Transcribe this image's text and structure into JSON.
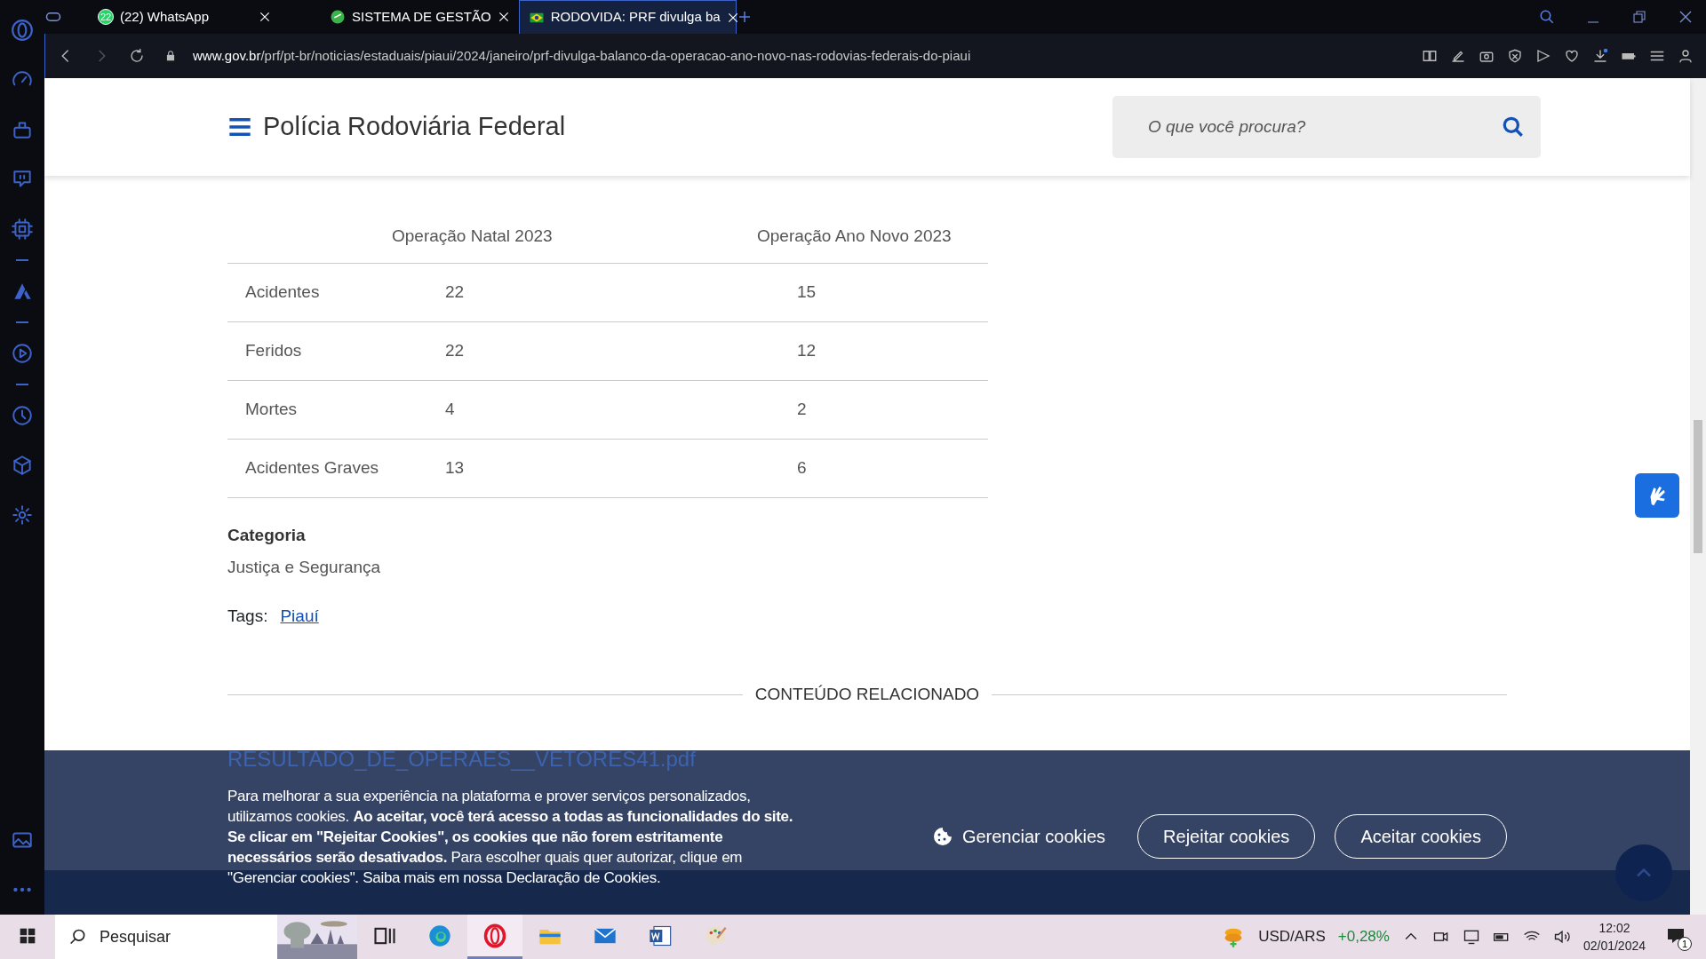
{
  "browser": {
    "tabs": [
      {
        "title": "(22) WhatsApp",
        "badge": "22",
        "kind": "whatsapp",
        "selected": false
      },
      {
        "title": "SISTEMA DE GESTÃO",
        "kind": "system",
        "selected": false
      },
      {
        "title": "RODOVIDA: PRF divulga ba",
        "kind": "flag",
        "selected": true
      }
    ],
    "url_host": "www.gov.br",
    "url_path": "/prf/pt-br/noticias/estaduais/piaui/2024/janeiro/prf-divulga-balanco-da-operacao-ano-novo-nas-rodovias-federais-do-piaui"
  },
  "sidebar": [
    {
      "kind": "speed"
    },
    {
      "kind": "broom"
    },
    {
      "kind": "chat"
    },
    {
      "kind": "chip"
    },
    {
      "kind": "divider"
    },
    {
      "kind": "aria"
    },
    {
      "kind": "divider"
    },
    {
      "kind": "play"
    },
    {
      "kind": "divider"
    },
    {
      "kind": "clock"
    },
    {
      "kind": "cube"
    },
    {
      "kind": "gear"
    }
  ],
  "site": {
    "title": "Polícia Rodoviária Federal",
    "search_placeholder": "O que você procura?"
  },
  "table": {
    "columns": [
      "Operação Natal 2023",
      "Operação Ano Novo 2023"
    ],
    "rows": [
      {
        "label": "Acidentes",
        "values": [
          "22",
          "15"
        ]
      },
      {
        "label": "Feridos",
        "values": [
          "22",
          "12"
        ]
      },
      {
        "label": "Mortes",
        "values": [
          "4",
          "2"
        ]
      },
      {
        "label": "Acidentes Graves",
        "values": [
          "13",
          "6"
        ]
      }
    ]
  },
  "category": {
    "heading": "Categoria",
    "value": "Justiça e Segurança"
  },
  "tags": {
    "label": "Tags:",
    "items": [
      "Piauí"
    ]
  },
  "related": {
    "heading": "CONTEÚDO RELACIONADO",
    "items": [
      "RESULTADO_DE_OPERAES__VETORES41.pdf"
    ]
  },
  "cookie_banner": {
    "text": "Para melhorar a sua experiência na plataforma e prover serviços personalizados, utilizamos cookies. **Ao aceitar, você terá acesso a todas as funcionalidades do site. Se clicar em \"Rejeitar Cookies\", os cookies que não forem estritamente necessários serão desativados.** Para escolher quais quer autorizar, clique em \"Gerenciar cookies\". Saiba mais em nossa",
    "link": "Declaração de Cookies",
    "suffix": ".",
    "buttons": [
      {
        "label": "Gerenciar cookies",
        "kind": "manage"
      },
      {
        "label": "Rejeitar cookies",
        "kind": "outline"
      },
      {
        "label": "Aceitar cookies",
        "kind": "outline"
      }
    ]
  },
  "taskbar": {
    "search_placeholder": "Pesquisar",
    "apps": [
      {
        "kind": "taskview",
        "selected": false
      },
      {
        "kind": "edge",
        "selected": false
      },
      {
        "kind": "opera",
        "selected": true
      },
      {
        "kind": "folder",
        "selected": false
      },
      {
        "kind": "mail",
        "selected": false
      },
      {
        "kind": "word",
        "selected": false
      },
      {
        "kind": "paint",
        "selected": false
      }
    ],
    "ticker": {
      "label": "USD/ARS",
      "change": "+0,28%"
    },
    "time": "12:02",
    "date": "02/01/2024",
    "notifications": "1"
  }
}
